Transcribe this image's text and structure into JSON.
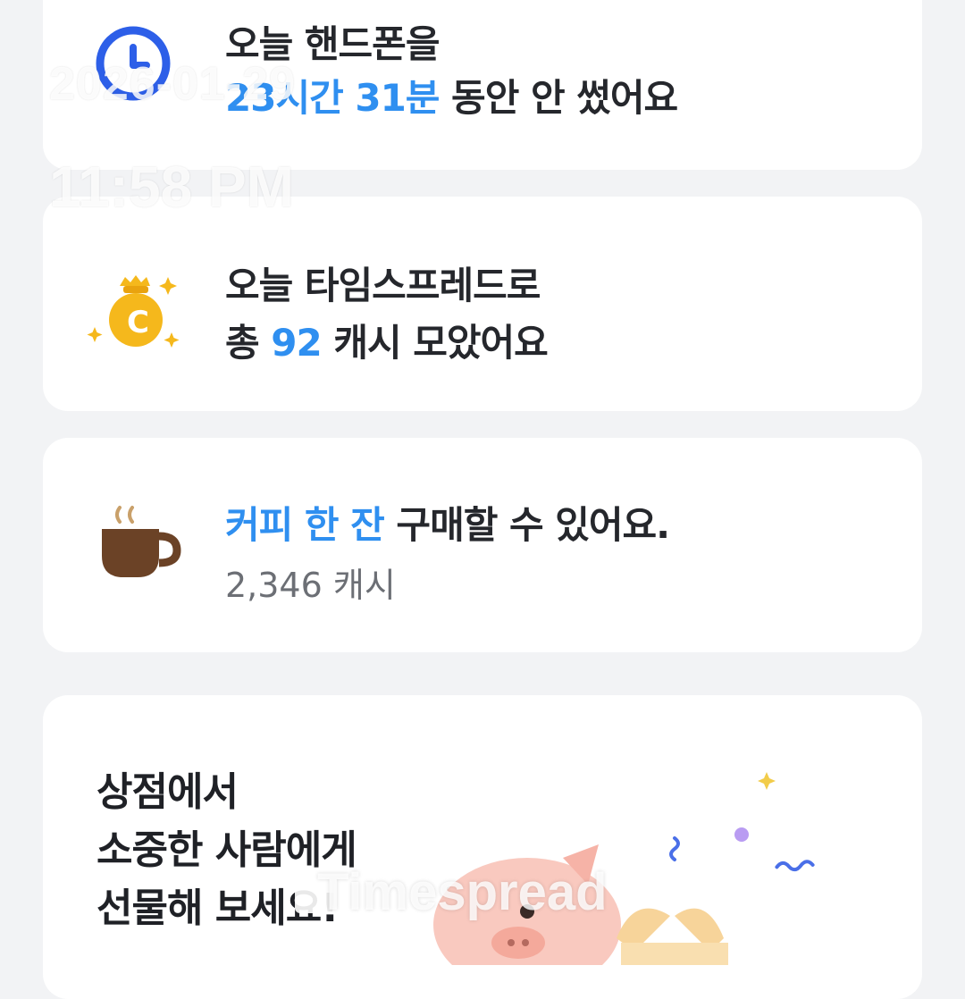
{
  "overlay": {
    "date": "2026-01-29",
    "time": "11:58 PM"
  },
  "card_screen_time": {
    "icon": "clock-icon",
    "line1": "오늘 핸드폰을",
    "duration": "23시간 31분",
    "line2_suffix": " 동안 안 썼어요"
  },
  "card_cash": {
    "icon": "money-bag-icon",
    "line1": "오늘 타임스프레드로",
    "prefix": "총 ",
    "amount": "92",
    "suffix": " 캐시 모았어요"
  },
  "card_coffee": {
    "icon": "coffee-cup-icon",
    "highlight": "커피 한 잔",
    "suffix": " 구매할 수 있어요.",
    "price": "2,346 캐시"
  },
  "card_shop": {
    "lines": [
      "상점에서",
      "소중한 사람에게",
      "선물해 보세요!"
    ],
    "illustration": "pig-gift-illustration"
  },
  "watermark": {
    "brand": "Timespread"
  },
  "colors": {
    "accent": "#2f8ff0",
    "clock": "#2d5fe8",
    "coin": "#f5b81c",
    "coffee": "#6b4226"
  }
}
